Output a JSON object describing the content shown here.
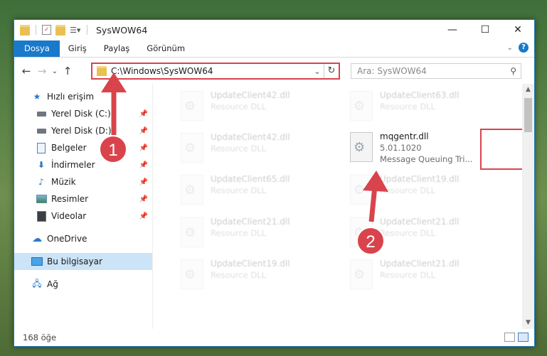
{
  "window": {
    "title": "SysWOW64",
    "controls": {
      "minimize": "—",
      "maximize": "☐",
      "close": "✕"
    }
  },
  "ribbon": {
    "tabs": [
      "Dosya",
      "Giriş",
      "Paylaş",
      "Görünüm"
    ],
    "expand_icon": "chevron-down-icon",
    "help_label": "?"
  },
  "address": {
    "path": "C:\\Windows\\SysWOW64",
    "search_placeholder": "Ara: SysWOW64"
  },
  "navigation": {
    "items": [
      {
        "label": "Hızlı erişim",
        "icon": "star-icon",
        "pinned": false
      },
      {
        "label": "Yerel Disk (C:)",
        "icon": "drive-icon",
        "pinned": true
      },
      {
        "label": "Yerel Disk (D:)",
        "icon": "drive-icon",
        "pinned": true
      },
      {
        "label": "Belgeler",
        "icon": "document-icon",
        "pinned": true
      },
      {
        "label": "İndirmeler",
        "icon": "download-icon",
        "pinned": true
      },
      {
        "label": "Müzik",
        "icon": "music-icon",
        "pinned": true
      },
      {
        "label": "Resimler",
        "icon": "pictures-icon",
        "pinned": true
      },
      {
        "label": "Videolar",
        "icon": "video-icon",
        "pinned": true
      },
      {
        "label": "OneDrive",
        "icon": "cloud-icon",
        "pinned": false
      },
      {
        "label": "Bu bilgisayar",
        "icon": "computer-icon",
        "pinned": false
      },
      {
        "label": "Ağ",
        "icon": "network-icon",
        "pinned": false
      }
    ]
  },
  "files": {
    "left_column": [
      {
        "name": "UpdateClient42.dll",
        "sub": "Resource DLL"
      },
      {
        "name": "UpdateClient42.dll",
        "sub": "Resource DLL"
      },
      {
        "name": "UpdateClient65.dll",
        "sub": "Resource DLL"
      },
      {
        "name": "UpdateClient21.dll",
        "sub": "Resource DLL"
      },
      {
        "name": "UpdateClient19.dll",
        "sub": "Resource DLL"
      }
    ],
    "right_column": [
      {
        "name": "UpdateClient63.dll",
        "sub": "Resource DLL"
      },
      {
        "name": "UpdateClient19.dll",
        "sub": "Resource DLL"
      },
      {
        "name": "UpdateClient21.dll",
        "sub": "Resource DLL"
      },
      {
        "name": "UpdateClient21.dll",
        "sub": "Resource DLL"
      }
    ],
    "highlighted": {
      "name": "mqgentr.dll",
      "version": "5.01.1020",
      "description": "Message Queuing Tri..."
    }
  },
  "status": {
    "item_count": "168 öğe"
  },
  "annotations": {
    "step1": "1",
    "step2": "2",
    "accent": "#d9444c"
  }
}
